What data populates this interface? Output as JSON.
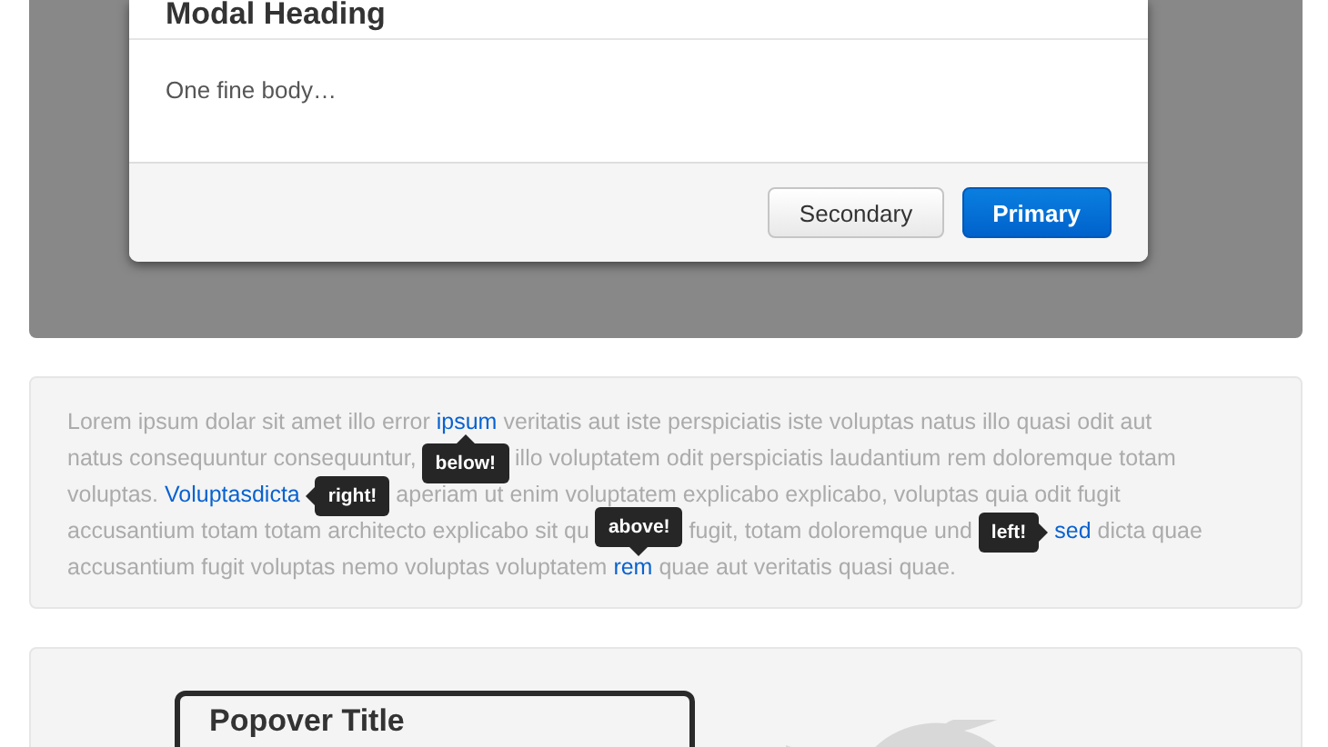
{
  "modal": {
    "heading": "Modal Heading",
    "body": "One fine body…",
    "buttons": [
      {
        "label": "Secondary",
        "kind": "secondary"
      },
      {
        "label": "Primary",
        "kind": "primary"
      }
    ]
  },
  "tooltip_demo": {
    "lines": [
      [
        {
          "kind": "text",
          "text": "Lorem ipsum dolar sit amet illo error"
        },
        {
          "kind": "link",
          "text": "ipsum"
        },
        {
          "kind": "text",
          "text": "veritatis aut iste perspiciatis iste voluptas natus illo quasi odit aut"
        }
      ],
      [
        {
          "kind": "text",
          "text": "natus consequuntur consequuntur,"
        },
        {
          "kind": "below",
          "text": "below!"
        },
        {
          "kind": "text",
          "text": "illo voluptatem odit perspiciatis laudantium rem doloremque totam"
        }
      ],
      [
        {
          "kind": "text",
          "text": "voluptas."
        },
        {
          "kind": "link",
          "text": "Voluptasdicta"
        },
        {
          "kind": "right",
          "text": "right!"
        },
        {
          "kind": "text",
          "text": "aperiam ut enim voluptatem explicabo explicabo, voluptas quia odit fugit"
        }
      ],
      [
        {
          "kind": "text",
          "text": "accusantium totam totam architecto explicabo sit qu"
        },
        {
          "kind": "above",
          "text": "above!"
        },
        {
          "kind": "text",
          "text": "fugit, totam doloremque und"
        },
        {
          "kind": "left",
          "text": "left!"
        },
        {
          "kind": "link",
          "text": "sed"
        },
        {
          "kind": "text",
          "text": "dicta quae"
        }
      ],
      [
        {
          "kind": "text",
          "text": "accusantium fugit voluptas nemo voluptas voluptatem"
        },
        {
          "kind": "link",
          "text": "rem"
        },
        {
          "kind": "text",
          "text": "quae aut veritatis quasi quae."
        }
      ]
    ]
  },
  "popover_demo": {
    "title": "Popover Title"
  }
}
